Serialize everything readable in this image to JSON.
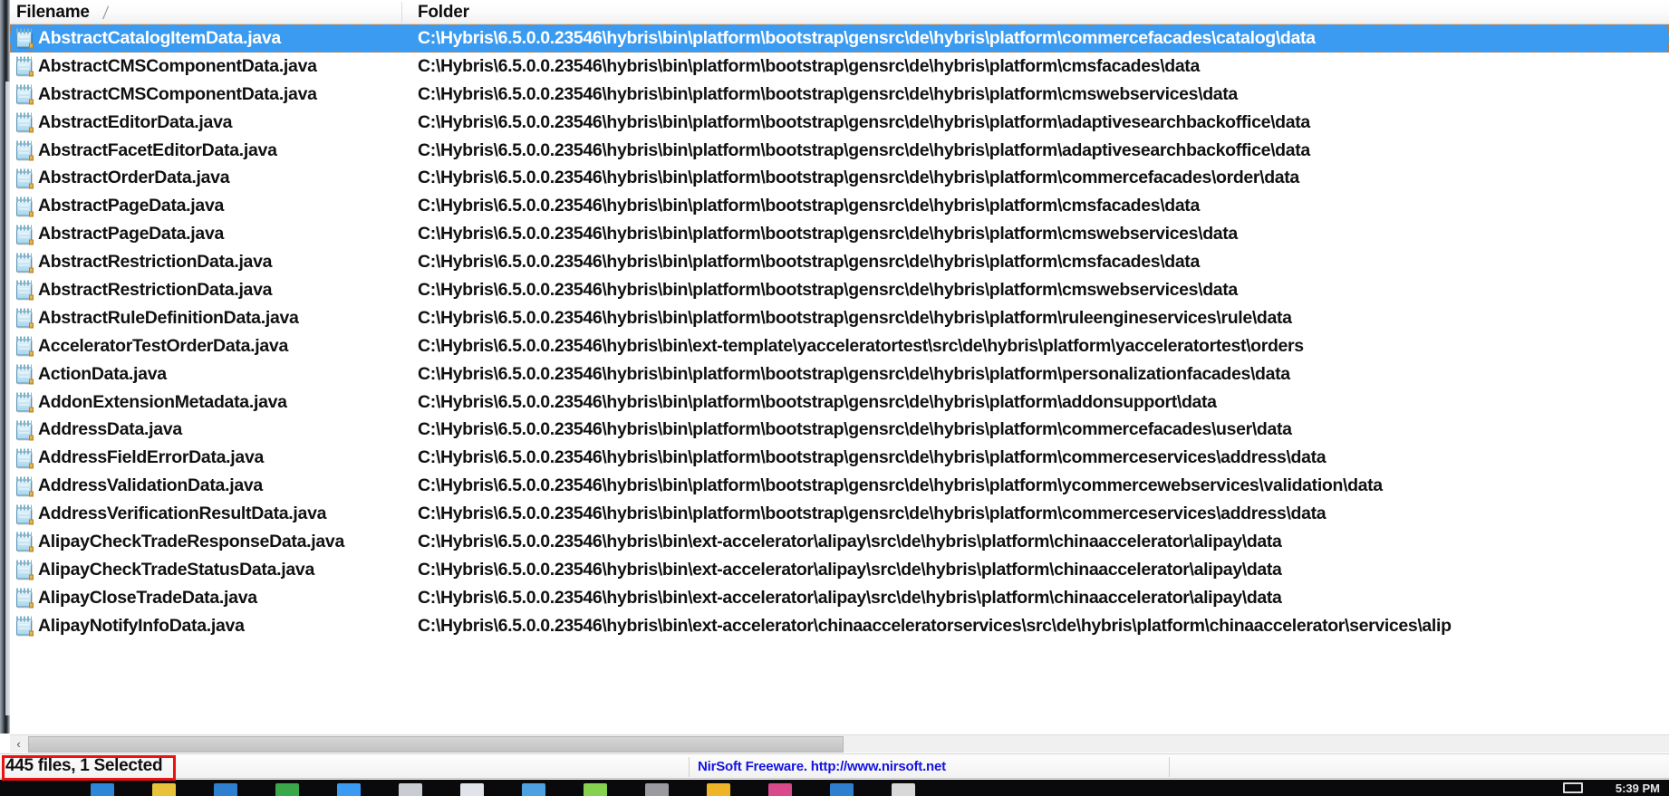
{
  "header": {
    "columns": [
      {
        "label": "Filename",
        "sort_indicator": "╱"
      },
      {
        "label": "Folder",
        "sort_indicator": ""
      }
    ]
  },
  "rows": [
    {
      "icon": "notepad-file-icon",
      "filename": "AbstractCatalogItemData.java",
      "folder": "C:\\Hybris\\6.5.0.0.23546\\hybris\\bin\\platform\\bootstrap\\gensrc\\de\\hybris\\platform\\commercefacades\\catalog\\data",
      "selected": true
    },
    {
      "icon": "notepad-file-icon",
      "filename": "AbstractCMSComponentData.java",
      "folder": "C:\\Hybris\\6.5.0.0.23546\\hybris\\bin\\platform\\bootstrap\\gensrc\\de\\hybris\\platform\\cmsfacades\\data",
      "selected": false
    },
    {
      "icon": "notepad-file-icon",
      "filename": "AbstractCMSComponentData.java",
      "folder": "C:\\Hybris\\6.5.0.0.23546\\hybris\\bin\\platform\\bootstrap\\gensrc\\de\\hybris\\platform\\cmswebservices\\data",
      "selected": false
    },
    {
      "icon": "notepad-file-icon",
      "filename": "AbstractEditorData.java",
      "folder": "C:\\Hybris\\6.5.0.0.23546\\hybris\\bin\\platform\\bootstrap\\gensrc\\de\\hybris\\platform\\adaptivesearchbackoffice\\data",
      "selected": false
    },
    {
      "icon": "notepad-file-icon",
      "filename": "AbstractFacetEditorData.java",
      "folder": "C:\\Hybris\\6.5.0.0.23546\\hybris\\bin\\platform\\bootstrap\\gensrc\\de\\hybris\\platform\\adaptivesearchbackoffice\\data",
      "selected": false
    },
    {
      "icon": "notepad-file-icon",
      "filename": "AbstractOrderData.java",
      "folder": "C:\\Hybris\\6.5.0.0.23546\\hybris\\bin\\platform\\bootstrap\\gensrc\\de\\hybris\\platform\\commercefacades\\order\\data",
      "selected": false
    },
    {
      "icon": "notepad-file-icon",
      "filename": "AbstractPageData.java",
      "folder": "C:\\Hybris\\6.5.0.0.23546\\hybris\\bin\\platform\\bootstrap\\gensrc\\de\\hybris\\platform\\cmsfacades\\data",
      "selected": false
    },
    {
      "icon": "notepad-file-icon",
      "filename": "AbstractPageData.java",
      "folder": "C:\\Hybris\\6.5.0.0.23546\\hybris\\bin\\platform\\bootstrap\\gensrc\\de\\hybris\\platform\\cmswebservices\\data",
      "selected": false
    },
    {
      "icon": "notepad-file-icon",
      "filename": "AbstractRestrictionData.java",
      "folder": "C:\\Hybris\\6.5.0.0.23546\\hybris\\bin\\platform\\bootstrap\\gensrc\\de\\hybris\\platform\\cmsfacades\\data",
      "selected": false
    },
    {
      "icon": "notepad-file-icon",
      "filename": "AbstractRestrictionData.java",
      "folder": "C:\\Hybris\\6.5.0.0.23546\\hybris\\bin\\platform\\bootstrap\\gensrc\\de\\hybris\\platform\\cmswebservices\\data",
      "selected": false
    },
    {
      "icon": "notepad-file-icon",
      "filename": "AbstractRuleDefinitionData.java",
      "folder": "C:\\Hybris\\6.5.0.0.23546\\hybris\\bin\\platform\\bootstrap\\gensrc\\de\\hybris\\platform\\ruleengineservices\\rule\\data",
      "selected": false
    },
    {
      "icon": "notepad-file-icon",
      "filename": "AcceleratorTestOrderData.java",
      "folder": "C:\\Hybris\\6.5.0.0.23546\\hybris\\bin\\ext-template\\yacceleratortest\\src\\de\\hybris\\platform\\yacceleratortest\\orders",
      "selected": false
    },
    {
      "icon": "notepad-file-icon",
      "filename": "ActionData.java",
      "folder": "C:\\Hybris\\6.5.0.0.23546\\hybris\\bin\\platform\\bootstrap\\gensrc\\de\\hybris\\platform\\personalizationfacades\\data",
      "selected": false
    },
    {
      "icon": "notepad-file-icon",
      "filename": "AddonExtensionMetadata.java",
      "folder": "C:\\Hybris\\6.5.0.0.23546\\hybris\\bin\\platform\\bootstrap\\gensrc\\de\\hybris\\platform\\addonsupport\\data",
      "selected": false
    },
    {
      "icon": "notepad-file-icon",
      "filename": "AddressData.java",
      "folder": "C:\\Hybris\\6.5.0.0.23546\\hybris\\bin\\platform\\bootstrap\\gensrc\\de\\hybris\\platform\\commercefacades\\user\\data",
      "selected": false
    },
    {
      "icon": "notepad-file-icon",
      "filename": "AddressFieldErrorData.java",
      "folder": "C:\\Hybris\\6.5.0.0.23546\\hybris\\bin\\platform\\bootstrap\\gensrc\\de\\hybris\\platform\\commerceservices\\address\\data",
      "selected": false
    },
    {
      "icon": "notepad-file-icon",
      "filename": "AddressValidationData.java",
      "folder": "C:\\Hybris\\6.5.0.0.23546\\hybris\\bin\\platform\\bootstrap\\gensrc\\de\\hybris\\platform\\ycommercewebservices\\validation\\data",
      "selected": false
    },
    {
      "icon": "notepad-file-icon",
      "filename": "AddressVerificationResultData.java",
      "folder": "C:\\Hybris\\6.5.0.0.23546\\hybris\\bin\\platform\\bootstrap\\gensrc\\de\\hybris\\platform\\commerceservices\\address\\data",
      "selected": false
    },
    {
      "icon": "notepad-file-icon",
      "filename": "AlipayCheckTradeResponseData.java",
      "folder": "C:\\Hybris\\6.5.0.0.23546\\hybris\\bin\\ext-accelerator\\alipay\\src\\de\\hybris\\platform\\chinaaccelerator\\alipay\\data",
      "selected": false
    },
    {
      "icon": "notepad-file-icon",
      "filename": "AlipayCheckTradeStatusData.java",
      "folder": "C:\\Hybris\\6.5.0.0.23546\\hybris\\bin\\ext-accelerator\\alipay\\src\\de\\hybris\\platform\\chinaaccelerator\\alipay\\data",
      "selected": false
    },
    {
      "icon": "notepad-file-icon",
      "filename": "AlipayCloseTradeData.java",
      "folder": "C:\\Hybris\\6.5.0.0.23546\\hybris\\bin\\ext-accelerator\\alipay\\src\\de\\hybris\\platform\\chinaaccelerator\\alipay\\data",
      "selected": false
    },
    {
      "icon": "notepad-file-icon",
      "filename": "AlipayNotifyInfoData.java",
      "folder": "C:\\Hybris\\6.5.0.0.23546\\hybris\\bin\\ext-accelerator\\chinaacceleratorservices\\src\\de\\hybris\\platform\\chinaaccelerator\\services\\alip",
      "selected": false
    }
  ],
  "scrollbars": {
    "horizontal_left_arrow": "‹"
  },
  "statusbar": {
    "left_text": "445 files, 1 Selected",
    "center_text": "NirSoft Freeware.  http://www.nirsoft.net"
  },
  "annotation": {
    "color": "#ee1111",
    "target": "445 files, 1 Selected"
  },
  "taskbar": {
    "time": "5:39 PM",
    "icon_colors": [
      "#2e86d8",
      "#e8c33a",
      "#2f7fd1",
      "#3aa84a",
      "#3b9bf0",
      "#c9cdd2",
      "#e0e4e8",
      "#4ea1e0",
      "#86d14e",
      "#9a9aa0",
      "#f0b429",
      "#d94a8c",
      "#2f7fd1",
      "#d8d8d8"
    ]
  },
  "colors": {
    "selection_blue": "#3b9bf0",
    "selection_focus_border": "#cc7a33",
    "link_blue": "#1414e0",
    "text_black": "#111111"
  }
}
